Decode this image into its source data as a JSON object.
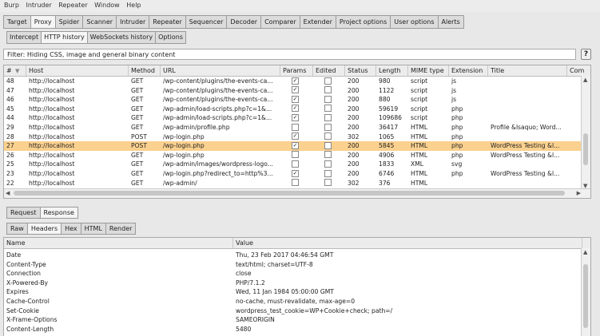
{
  "menu": [
    "Burp",
    "Intruder",
    "Repeater",
    "Window",
    "Help"
  ],
  "main_tabs": [
    {
      "label": "Target",
      "active": false
    },
    {
      "label": "Proxy",
      "active": true
    },
    {
      "label": "Spider",
      "active": false
    },
    {
      "label": "Scanner",
      "active": false
    },
    {
      "label": "Intruder",
      "active": false
    },
    {
      "label": "Repeater",
      "active": false
    },
    {
      "label": "Sequencer",
      "active": false
    },
    {
      "label": "Decoder",
      "active": false
    },
    {
      "label": "Comparer",
      "active": false
    },
    {
      "label": "Extender",
      "active": false
    },
    {
      "label": "Project options",
      "active": false
    },
    {
      "label": "User options",
      "active": false
    },
    {
      "label": "Alerts",
      "active": false
    }
  ],
  "proxy_tabs": [
    {
      "label": "Intercept",
      "active": false
    },
    {
      "label": "HTTP history",
      "active": true
    },
    {
      "label": "WebSockets history",
      "active": false
    },
    {
      "label": "Options",
      "active": false
    }
  ],
  "filter": {
    "text": "Filter: Hiding CSS, image and general binary content",
    "help_label": "?"
  },
  "history": {
    "columns": [
      "#",
      "Host",
      "Method",
      "URL",
      "Params",
      "Edited",
      "Status",
      "Length",
      "MIME type",
      "Extension",
      "Title",
      "Com"
    ],
    "sort_indicator": "▼",
    "rows": [
      {
        "num": "48",
        "host": "http://localhost",
        "method": "GET",
        "url": "/wp-content/plugins/the-events-ca...",
        "params": true,
        "edited": false,
        "status": "200",
        "length": "980",
        "mime": "script",
        "ext": "js",
        "title": "",
        "selected": false
      },
      {
        "num": "47",
        "host": "http://localhost",
        "method": "GET",
        "url": "/wp-content/plugins/the-events-ca...",
        "params": true,
        "edited": false,
        "status": "200",
        "length": "1122",
        "mime": "script",
        "ext": "js",
        "title": "",
        "selected": false
      },
      {
        "num": "46",
        "host": "http://localhost",
        "method": "GET",
        "url": "/wp-content/plugins/the-events-ca...",
        "params": true,
        "edited": false,
        "status": "200",
        "length": "880",
        "mime": "script",
        "ext": "js",
        "title": "",
        "selected": false
      },
      {
        "num": "45",
        "host": "http://localhost",
        "method": "GET",
        "url": "/wp-admin/load-scripts.php?c=1&...",
        "params": true,
        "edited": false,
        "status": "200",
        "length": "59619",
        "mime": "script",
        "ext": "php",
        "title": "",
        "selected": false
      },
      {
        "num": "44",
        "host": "http://localhost",
        "method": "GET",
        "url": "/wp-admin/load-scripts.php?c=1&...",
        "params": true,
        "edited": false,
        "status": "200",
        "length": "109686",
        "mime": "script",
        "ext": "php",
        "title": "",
        "selected": false
      },
      {
        "num": "29",
        "host": "http://localhost",
        "method": "GET",
        "url": "/wp-admin/profile.php",
        "params": false,
        "edited": false,
        "status": "200",
        "length": "36417",
        "mime": "HTML",
        "ext": "php",
        "title": "Profile &lsaquo; Word...",
        "selected": false
      },
      {
        "num": "28",
        "host": "http://localhost",
        "method": "POST",
        "url": "/wp-login.php",
        "params": true,
        "edited": false,
        "status": "302",
        "length": "1065",
        "mime": "HTML",
        "ext": "php",
        "title": "",
        "selected": false
      },
      {
        "num": "27",
        "host": "http://localhost",
        "method": "POST",
        "url": "/wp-login.php",
        "params": true,
        "edited": false,
        "status": "200",
        "length": "5845",
        "mime": "HTML",
        "ext": "php",
        "title": "WordPress Testing &l...",
        "selected": true
      },
      {
        "num": "26",
        "host": "http://localhost",
        "method": "GET",
        "url": "/wp-login.php",
        "params": false,
        "edited": false,
        "status": "200",
        "length": "4906",
        "mime": "HTML",
        "ext": "php",
        "title": "WordPress Testing &l...",
        "selected": false
      },
      {
        "num": "25",
        "host": "http://localhost",
        "method": "GET",
        "url": "/wp-admin/images/wordpress-logo...",
        "params": false,
        "edited": false,
        "status": "200",
        "length": "1833",
        "mime": "XML",
        "ext": "svg",
        "title": "",
        "selected": false
      },
      {
        "num": "23",
        "host": "http://localhost",
        "method": "GET",
        "url": "/wp-login.php?redirect_to=http%3...",
        "params": true,
        "edited": false,
        "status": "200",
        "length": "6746",
        "mime": "HTML",
        "ext": "php",
        "title": "WordPress Testing &l...",
        "selected": false
      },
      {
        "num": "22",
        "host": "http://localhost",
        "method": "GET",
        "url": "/wp-admin/",
        "params": false,
        "edited": false,
        "status": "302",
        "length": "376",
        "mime": "HTML",
        "ext": "",
        "title": "",
        "selected": false
      }
    ]
  },
  "reqresp_tabs": [
    {
      "label": "Request",
      "active": false
    },
    {
      "label": "Response",
      "active": true
    }
  ],
  "view_tabs": [
    {
      "label": "Raw",
      "active": false
    },
    {
      "label": "Headers",
      "active": true
    },
    {
      "label": "Hex",
      "active": false
    },
    {
      "label": "HTML",
      "active": false
    },
    {
      "label": "Render",
      "active": false
    }
  ],
  "headers": {
    "columns": [
      "Name",
      "Value"
    ],
    "rows": [
      {
        "name": "Date",
        "value": "Thu, 23 Feb 2017 04:46:54 GMT"
      },
      {
        "name": "Content-Type",
        "value": "text/html; charset=UTF-8"
      },
      {
        "name": "Connection",
        "value": "close"
      },
      {
        "name": "X-Powered-By",
        "value": "PHP/7.1.2"
      },
      {
        "name": "Expires",
        "value": "Wed, 11 Jan 1984 05:00:00 GMT"
      },
      {
        "name": "Cache-Control",
        "value": "no-cache, must-revalidate, max-age=0"
      },
      {
        "name": "Set-Cookie",
        "value": "wordpress_test_cookie=WP+Cookie+check; path=/"
      },
      {
        "name": "X-Frame-Options",
        "value": "SAMEORIGIN"
      },
      {
        "name": "Content-Length",
        "value": "5480"
      }
    ]
  },
  "colors": {
    "selected_row": "#fbd18f",
    "tab_active": "#f5f5f5",
    "tab_inactive": "#dcdcdc"
  }
}
